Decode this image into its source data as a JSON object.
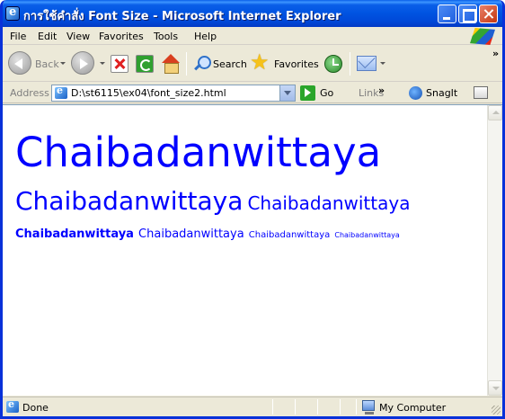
{
  "window": {
    "title": "การใช้คำสั่ง Font Size - Microsoft Internet Explorer"
  },
  "menu": {
    "items": [
      "File",
      "Edit",
      "View",
      "Favorites",
      "Tools",
      "Help"
    ]
  },
  "toolbar": {
    "back_label": "Back",
    "search_label": "Search",
    "favorites_label": "Favorites"
  },
  "address": {
    "label": "Address",
    "url": "D:\\st6115\\ex04\\font_size2.html",
    "go_label": "Go",
    "links_label": "Links",
    "snagit_label": "SnagIt"
  },
  "page": {
    "lines": [
      [
        "Chaibadanwittaya"
      ],
      [
        "Chaibadanwittaya",
        "Chaibadanwittaya"
      ],
      [
        "Chaibadanwittaya",
        "Chaibadanwittaya",
        "Chaibadanwittaya",
        "Chaibadanwittaya"
      ]
    ],
    "text_color": "#0000ff"
  },
  "status": {
    "text": "Done",
    "zone": "My Computer"
  },
  "colors": {
    "titlebar": "#0054e3",
    "chrome": "#ece9d8"
  }
}
